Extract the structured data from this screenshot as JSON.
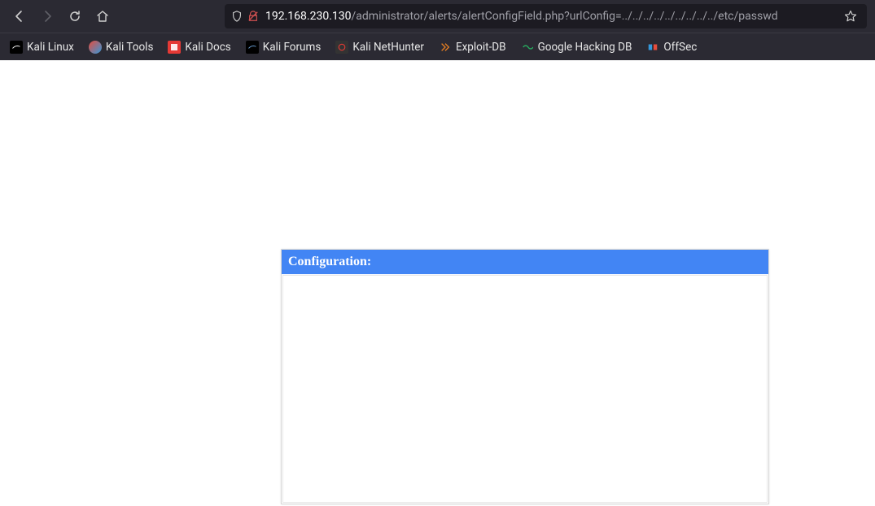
{
  "url": {
    "domain": "192.168.230.130",
    "path": "/administrator/alerts/alertConfigField.php?urlConfig=../../../../../../../../../etc/passwd"
  },
  "bookmarks": [
    {
      "label": "Kali Linux",
      "icon": "kali-linux"
    },
    {
      "label": "Kali Tools",
      "icon": "kali-tools"
    },
    {
      "label": "Kali Docs",
      "icon": "kali-docs"
    },
    {
      "label": "Kali Forums",
      "icon": "kali-forums"
    },
    {
      "label": "Kali NetHunter",
      "icon": "kali-nethunter"
    },
    {
      "label": "Exploit-DB",
      "icon": "exploit-db"
    },
    {
      "label": "Google Hacking DB",
      "icon": "ghdb"
    },
    {
      "label": "OffSec",
      "icon": "offsec"
    }
  ],
  "page": {
    "config_header": "Configuration:",
    "config_body": ""
  }
}
